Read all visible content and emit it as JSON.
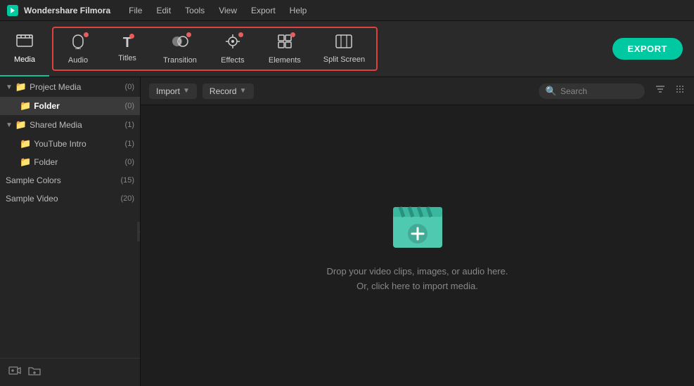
{
  "app": {
    "name": "Wondershare Filmora",
    "logo_color": "#00c8a0"
  },
  "menu": {
    "items": [
      "File",
      "Edit",
      "Tools",
      "View",
      "Export",
      "Help"
    ]
  },
  "toolbar": {
    "items": [
      {
        "id": "media",
        "label": "Media",
        "icon": "🎞",
        "active": true,
        "dot": false
      },
      {
        "id": "audio",
        "label": "Audio",
        "icon": "♪",
        "active": false,
        "dot": true
      },
      {
        "id": "titles",
        "label": "Titles",
        "icon": "T",
        "active": false,
        "dot": true
      },
      {
        "id": "transition",
        "label": "Transition",
        "icon": "◑",
        "active": false,
        "dot": true
      },
      {
        "id": "effects",
        "label": "Effects",
        "icon": "✦",
        "active": false,
        "dot": true
      },
      {
        "id": "elements",
        "label": "Elements",
        "icon": "⊞",
        "active": false,
        "dot": true
      },
      {
        "id": "split_screen",
        "label": "Split Screen",
        "icon": "⊡",
        "active": false,
        "dot": false
      }
    ],
    "outlined_start": 1,
    "outlined_end": 6,
    "export_label": "EXPORT"
  },
  "sidebar": {
    "sections": [
      {
        "id": "project-media",
        "label": "Project Media",
        "count": "(0)",
        "expanded": true,
        "children": [
          {
            "id": "folder-project",
            "label": "Folder",
            "count": "(0)",
            "selected": true
          }
        ]
      },
      {
        "id": "shared-media",
        "label": "Shared Media",
        "count": "(1)",
        "expanded": true,
        "children": [
          {
            "id": "youtube-intro",
            "label": "YouTube Intro",
            "count": "(1)",
            "selected": false
          },
          {
            "id": "folder-shared",
            "label": "Folder",
            "count": "(0)",
            "selected": false
          }
        ]
      }
    ],
    "flat_items": [
      {
        "id": "sample-colors",
        "label": "Sample Colors",
        "count": "(15)"
      },
      {
        "id": "sample-video",
        "label": "Sample Video",
        "count": "(20)"
      }
    ],
    "bottom_icons": [
      "add-folder-icon",
      "new-folder-icon"
    ]
  },
  "content_toolbar": {
    "import_label": "Import",
    "record_label": "Record",
    "search_placeholder": "Search"
  },
  "drop_zone": {
    "line1": "Drop your video clips, images, or audio here.",
    "line2": "Or, click here to import media."
  }
}
